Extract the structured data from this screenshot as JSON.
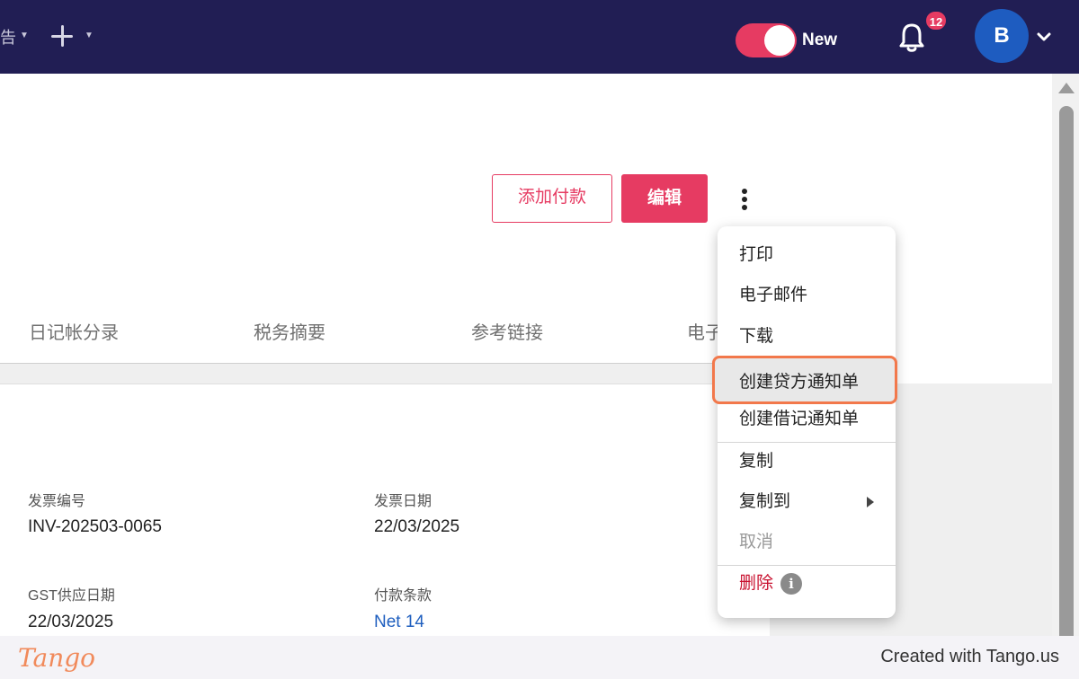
{
  "topbar": {
    "left_fragment": "告",
    "toggle_label": "New",
    "notification_count": "12",
    "avatar_initial": "B"
  },
  "actions": {
    "add_payment": "添加付款",
    "edit": "编辑"
  },
  "tabs": [
    "日记帐分录",
    "税务摘要",
    "参考链接",
    "电子"
  ],
  "fields": {
    "invoice_number_label": "发票编号",
    "invoice_number_value": "INV-202503-0065",
    "invoice_date_label": "发票日期",
    "invoice_date_value": "22/03/2025",
    "gst_supply_date_label": "GST供应日期",
    "gst_supply_date_value": "22/03/2025",
    "payment_terms_label": "付款条款",
    "payment_terms_value": "Net 14"
  },
  "menu": {
    "print": "打印",
    "email": "电子邮件",
    "download": "下载",
    "create_credit_note": "创建贷方通知单",
    "create_debit_note": "创建借记通知单",
    "copy": "复制",
    "copy_to": "复制到",
    "cancel": "取消",
    "delete": "删除"
  },
  "footer": {
    "logo": "Tango",
    "credit": "Created with Tango.us"
  },
  "colors": {
    "nav_bg": "#211e54",
    "accent": "#e63b62",
    "highlight_border": "#f2784b",
    "link": "#1f5fbf"
  }
}
